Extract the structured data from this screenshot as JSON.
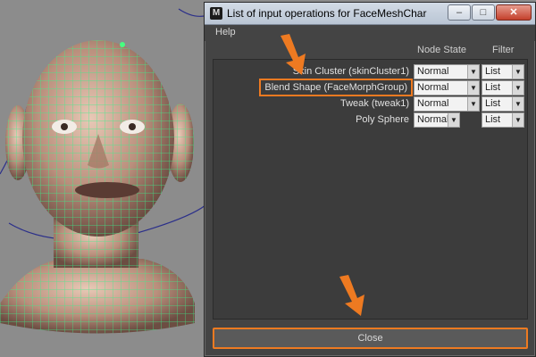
{
  "window": {
    "title": "List of input operations for FaceMeshChar",
    "icon": "maya-icon",
    "buttons": {
      "minimize": "–",
      "maximize": "□",
      "close": "✕"
    }
  },
  "menu": {
    "help": "Help"
  },
  "columns": {
    "node_state": "Node State",
    "filter": "Filter"
  },
  "operations": [
    {
      "label": "Skin Cluster (skinCluster1)",
      "state": "Normal",
      "filter": "List",
      "highlighted": false
    },
    {
      "label": "Blend Shape (FaceMorphGroup)",
      "state": "Normal",
      "filter": "List",
      "highlighted": true
    },
    {
      "label": "Tweak (tweak1)",
      "state": "Normal",
      "filter": "List",
      "highlighted": false
    },
    {
      "label": "Poly Sphere",
      "state": "Normal",
      "filter": "List",
      "highlighted": false
    }
  ],
  "close_label": "Close",
  "colors": {
    "highlight": "#ee7a21",
    "wireframe": "#3bf08c",
    "window_bg": "#444444"
  }
}
